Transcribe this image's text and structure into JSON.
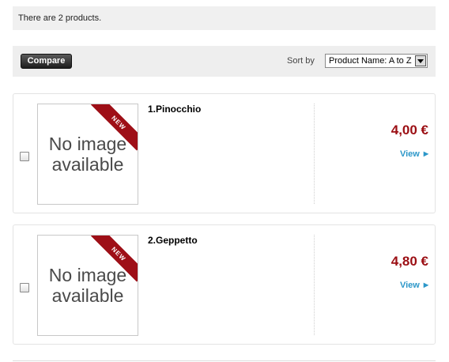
{
  "product_count_text": "There are 2 products.",
  "toolbar": {
    "compare_label": "Compare",
    "sort_label": "Sort by",
    "sort_selected": "Product Name: A to Z"
  },
  "products": [
    {
      "title": "1.Pinocchio",
      "price": "4,00 €",
      "view_label": "View",
      "image_text": "No image available",
      "badge": "NEW"
    },
    {
      "title": "2.Geppetto",
      "price": "4,80 €",
      "view_label": "View",
      "image_text": "No image available",
      "badge": "NEW"
    }
  ],
  "colors": {
    "price": "#9b0e13",
    "link": "#2c97c9",
    "badge": "#9e0f17",
    "bar_background": "#f0f0f0"
  }
}
